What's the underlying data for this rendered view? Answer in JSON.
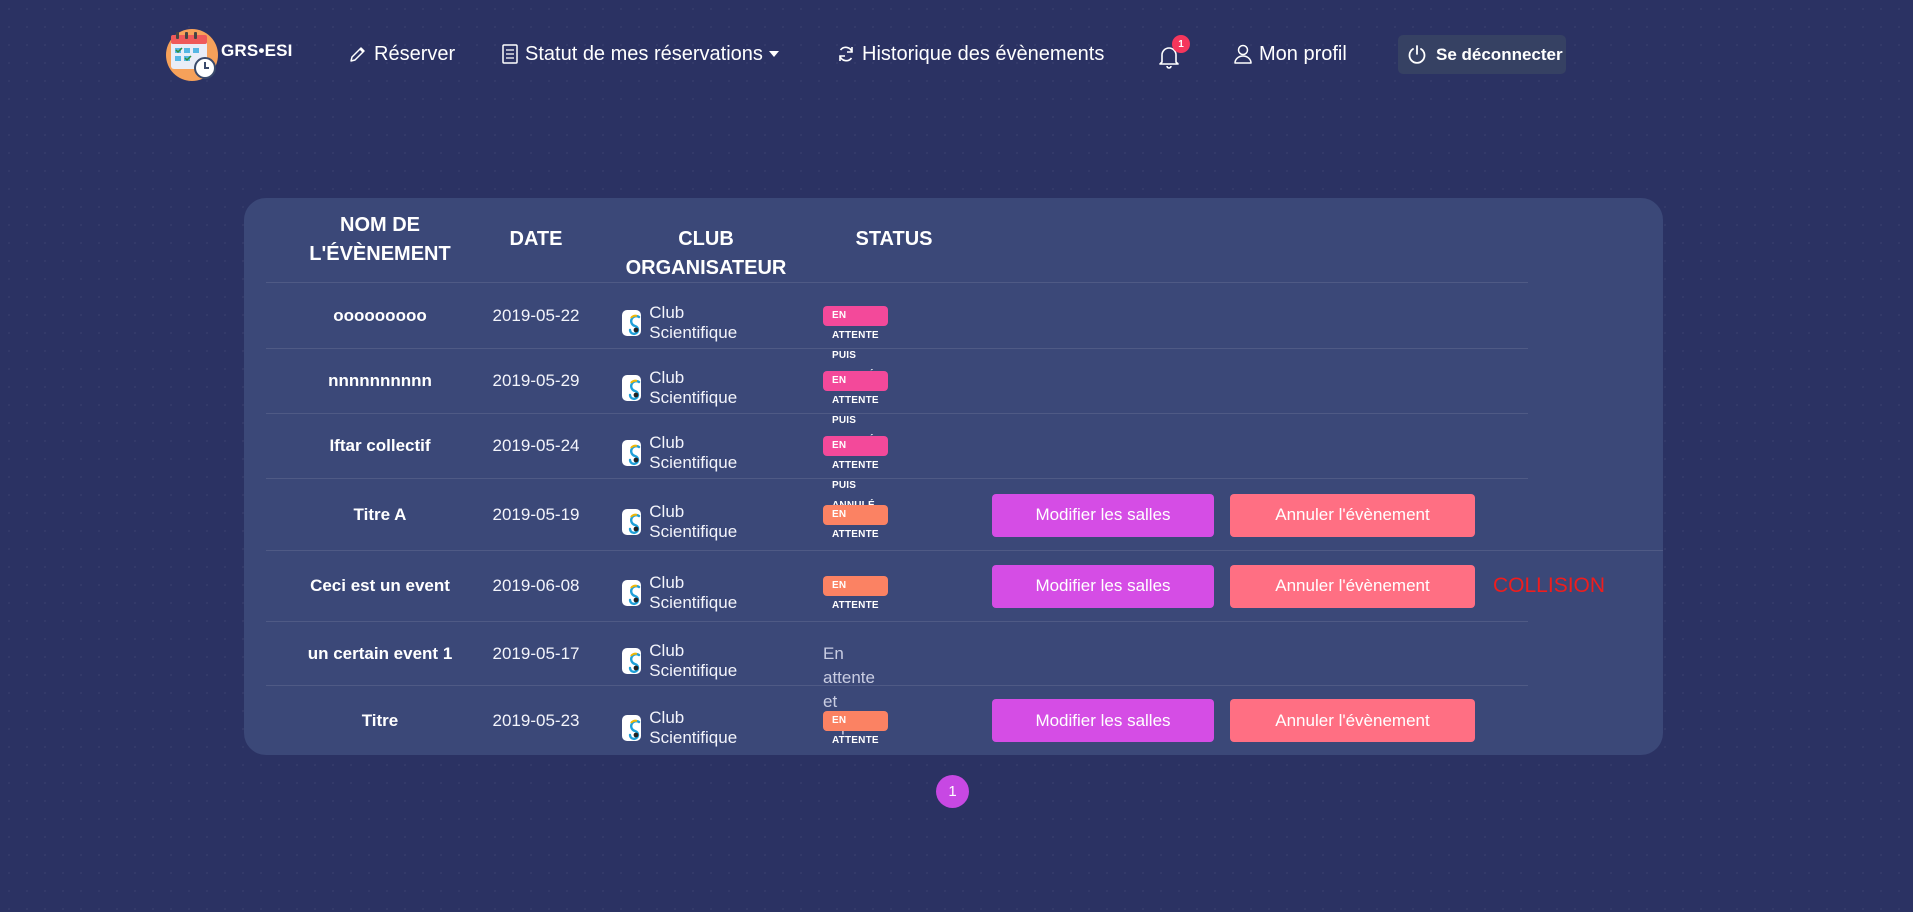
{
  "nav": {
    "brand": "GRS•ESI",
    "reserve": "Réserver",
    "status": "Statut de mes réservations",
    "history": "Historique des évènements",
    "notifications_count": "1",
    "profile": "Mon profil",
    "logout": "Se déconnecter"
  },
  "table": {
    "headers": {
      "name_line1": "NOM DE",
      "name_line2": "L'ÉVÈNEMENT",
      "date": "DATE",
      "club": "CLUB ORGANISATEUR",
      "status": "STATUS"
    },
    "modify_label": "Modifier les salles",
    "cancel_label": "Annuler l'évènement",
    "rows": [
      {
        "name": "ooooooooo",
        "date": "2019-05-22",
        "club": "Club Scientifique",
        "status": "EN ATTENTE PUIS ANNULÉ",
        "status_style": "danger"
      },
      {
        "name": "nnnnnnnnnn",
        "date": "2019-05-29",
        "club": "Club Scientifique",
        "status": "EN ATTENTE PUIS ANNULÉ",
        "status_style": "danger"
      },
      {
        "name": "Iftar collectif",
        "date": "2019-05-24",
        "club": "Club Scientifique",
        "status": "EN ATTENTE PUIS ANNULÉ",
        "status_style": "danger"
      },
      {
        "name": "Titre A",
        "date": "2019-05-19",
        "club": "Club Scientifique",
        "status": "EN ATTENTE",
        "status_style": "warning"
      },
      {
        "name": "Ceci est un event",
        "date": "2019-06-08",
        "club": "Club Scientifique",
        "status": "EN ATTENTE",
        "status_style": "warning",
        "note": "COLLISION"
      },
      {
        "name": "un certain event 1",
        "date": "2019-05-17",
        "club": "Club Scientifique",
        "status": "En attente et expiré",
        "status_style": "text"
      },
      {
        "name": "Titre",
        "date": "2019-05-23",
        "club": "Club Scientifique",
        "status": "EN ATTENTE",
        "status_style": "warning"
      }
    ]
  },
  "pagination": {
    "current": "1"
  },
  "colors": {
    "background": "#2b3263",
    "card": "#3b4878",
    "badge_danger": "#f3499a",
    "badge_warning": "#fb8263",
    "modify_button": "#d54de5",
    "cancel_button": "#ff6f83",
    "collision_text": "#ef1d1d",
    "notification_badge": "#f5365c",
    "pagination_active": "#c748e3"
  }
}
